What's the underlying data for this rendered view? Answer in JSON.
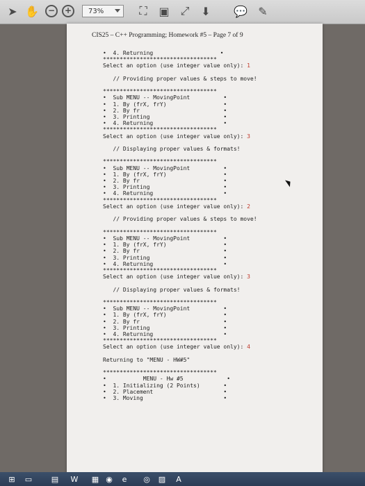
{
  "toolbar": {
    "zoom": "73%"
  },
  "page": {
    "header": "CIS25 – C++ Programming; Homework #5 – Page 7 of 9"
  },
  "console_lines": [
    {
      "t": "•  4. Returning                    •"
    },
    {
      "t": "**********************************"
    },
    {
      "t": "Select an option (use integer value only): ",
      "input": "1"
    },
    {
      "t": ""
    },
    {
      "t": "   // Providing proper values & steps to move!"
    },
    {
      "t": ""
    },
    {
      "t": "**********************************"
    },
    {
      "t": "•  Sub MENU -- MovingPoint          •"
    },
    {
      "t": "•  1. By (frX, frY)                 •"
    },
    {
      "t": "•  2. By fr                         •"
    },
    {
      "t": "•  3. Printing                      •"
    },
    {
      "t": "•  4. Returning                     •"
    },
    {
      "t": "**********************************"
    },
    {
      "t": "Select an option (use integer value only): ",
      "input": "3"
    },
    {
      "t": ""
    },
    {
      "t": "   // Displaying proper values & formats!"
    },
    {
      "t": ""
    },
    {
      "t": "**********************************"
    },
    {
      "t": "•  Sub MENU -- MovingPoint          •"
    },
    {
      "t": "•  1. By (frX, frY)                 •"
    },
    {
      "t": "•  2. By fr                         •"
    },
    {
      "t": "•  3. Printing                      •"
    },
    {
      "t": "•  4. Returning                     •"
    },
    {
      "t": "**********************************"
    },
    {
      "t": "Select an option (use integer value only): ",
      "input": "2"
    },
    {
      "t": ""
    },
    {
      "t": "   // Providing proper values & steps to move!"
    },
    {
      "t": ""
    },
    {
      "t": "**********************************"
    },
    {
      "t": "•  Sub MENU -- MovingPoint          •"
    },
    {
      "t": "•  1. By (frX, frY)                 •"
    },
    {
      "t": "•  2. By fr                         •"
    },
    {
      "t": "•  3. Printing                      •"
    },
    {
      "t": "•  4. Returning                     •"
    },
    {
      "t": "**********************************"
    },
    {
      "t": "Select an option (use integer value only): ",
      "input": "3"
    },
    {
      "t": ""
    },
    {
      "t": "   // Displaying proper values & formats!"
    },
    {
      "t": ""
    },
    {
      "t": "**********************************"
    },
    {
      "t": "•  Sub MENU -- MovingPoint          •"
    },
    {
      "t": "•  1. By (frX, frY)                 •"
    },
    {
      "t": "•  2. By fr                         •"
    },
    {
      "t": "•  3. Printing                      •"
    },
    {
      "t": "•  4. Returning                     •"
    },
    {
      "t": "**********************************"
    },
    {
      "t": "Select an option (use integer value only): ",
      "input": "4"
    },
    {
      "t": ""
    },
    {
      "t": "Returning to \"MENU - HW#5\""
    },
    {
      "t": ""
    },
    {
      "t": "**********************************"
    },
    {
      "t": "•           MENU - Hw #5             •"
    },
    {
      "t": "•  1. Initializing (2 Points)       •"
    },
    {
      "t": "•  2. Placement                     •"
    },
    {
      "t": "•  3. Moving                        •"
    }
  ],
  "colors": {
    "input": "#c0392b",
    "toolbar": "#d2d2d2",
    "taskbar": "#2f4059"
  },
  "icons": [
    "arrow-pointer-icon",
    "hand-icon",
    "minus-circle-icon",
    "plus-circle-icon",
    "fit-page-icon",
    "fit-width-icon",
    "full-screen-icon",
    "download-icon",
    "comment-icon",
    "pen-icon"
  ]
}
